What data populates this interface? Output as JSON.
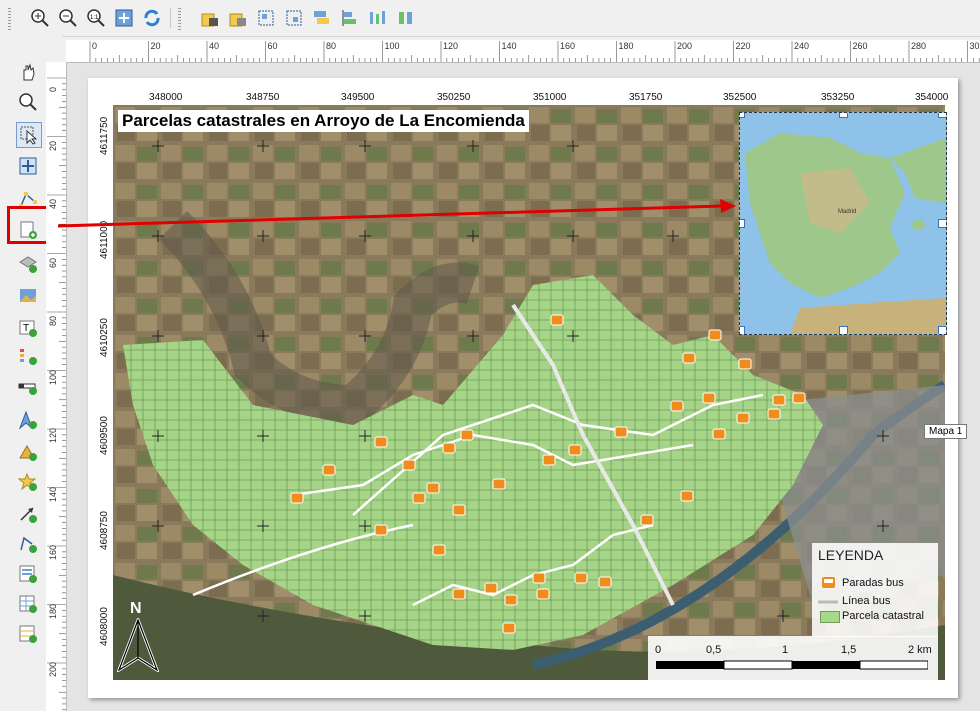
{
  "toolbar": {
    "icons": [
      "zoom-in-icon",
      "zoom-out-icon",
      "zoom-100-icon",
      "zoom-full-icon",
      "refresh-icon",
      "lock-items-icon",
      "unlock-items-icon",
      "group-icon",
      "ungroup-icon",
      "raise-icon",
      "align-icon",
      "distribute-icon",
      "resize-icon"
    ]
  },
  "left_tools": {
    "icons": [
      "pan-icon",
      "zoom-tool-icon",
      "select-move-icon",
      "move-content-icon",
      "edit-nodes-icon",
      "add-map-icon",
      "add-3d-map-icon",
      "add-picture-icon",
      "add-label-icon",
      "add-legend-icon",
      "add-scalebar-icon",
      "add-north-arrow-icon",
      "add-shape-icon",
      "add-marker-icon",
      "add-arrow-icon",
      "add-polyline-icon",
      "add-html-icon",
      "add-attribute-table-icon",
      "add-fixed-table-icon"
    ]
  },
  "ruler": {
    "h_labels": [
      "0",
      "20",
      "40",
      "60",
      "80",
      "100",
      "120",
      "140",
      "160",
      "180",
      "200",
      "220",
      "240",
      "260",
      "280",
      "30"
    ],
    "v_labels": [
      "0",
      "20",
      "40",
      "60",
      "80",
      "100",
      "120",
      "140",
      "160",
      "180",
      "200"
    ]
  },
  "map": {
    "title": "Parcelas catastrales en Arroyo de La Encomienda",
    "x_coords": [
      "348000",
      "348750",
      "349500",
      "350250",
      "351000",
      "351750",
      "352500",
      "353250",
      "354000"
    ],
    "y_coords": [
      "4611750",
      "4611000",
      "4610250",
      "4609500",
      "4608750",
      "4608000"
    ],
    "item_label": "Mapa 1",
    "north_label": "N"
  },
  "legend": {
    "title": "LEYENDA",
    "items": [
      {
        "label": "Paradas bus",
        "color": "#f08c1c"
      },
      {
        "label": "Línea bus",
        "color": "#ffffff"
      },
      {
        "label": "Parcela catastral",
        "color": "#a7d98a"
      }
    ]
  },
  "scalebar": {
    "labels": [
      "0",
      "0,5",
      "1",
      "1,5",
      "2 km"
    ]
  },
  "colors": {
    "highlight": "#e00000",
    "parcel": "#a7d98a",
    "bus_stop": "#f08c1c"
  }
}
